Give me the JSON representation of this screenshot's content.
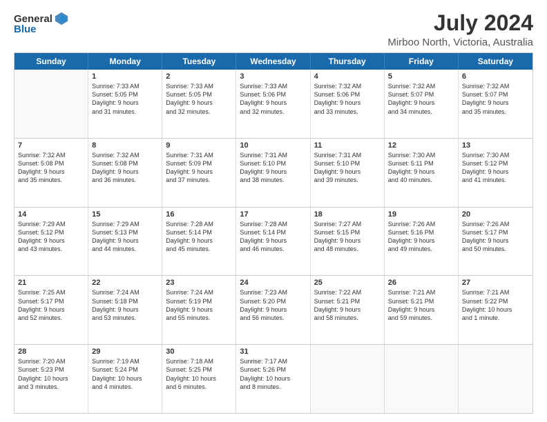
{
  "logo": {
    "general": "General",
    "blue": "Blue"
  },
  "title": "July 2024",
  "location": "Mirboo North, Victoria, Australia",
  "days_of_week": [
    "Sunday",
    "Monday",
    "Tuesday",
    "Wednesday",
    "Thursday",
    "Friday",
    "Saturday"
  ],
  "weeks": [
    [
      {
        "day": "",
        "lines": []
      },
      {
        "day": "1",
        "lines": [
          "Sunrise: 7:33 AM",
          "Sunset: 5:05 PM",
          "Daylight: 9 hours",
          "and 31 minutes."
        ]
      },
      {
        "day": "2",
        "lines": [
          "Sunrise: 7:33 AM",
          "Sunset: 5:05 PM",
          "Daylight: 9 hours",
          "and 32 minutes."
        ]
      },
      {
        "day": "3",
        "lines": [
          "Sunrise: 7:33 AM",
          "Sunset: 5:06 PM",
          "Daylight: 9 hours",
          "and 32 minutes."
        ]
      },
      {
        "day": "4",
        "lines": [
          "Sunrise: 7:32 AM",
          "Sunset: 5:06 PM",
          "Daylight: 9 hours",
          "and 33 minutes."
        ]
      },
      {
        "day": "5",
        "lines": [
          "Sunrise: 7:32 AM",
          "Sunset: 5:07 PM",
          "Daylight: 9 hours",
          "and 34 minutes."
        ]
      },
      {
        "day": "6",
        "lines": [
          "Sunrise: 7:32 AM",
          "Sunset: 5:07 PM",
          "Daylight: 9 hours",
          "and 35 minutes."
        ]
      }
    ],
    [
      {
        "day": "7",
        "lines": [
          "Sunrise: 7:32 AM",
          "Sunset: 5:08 PM",
          "Daylight: 9 hours",
          "and 35 minutes."
        ]
      },
      {
        "day": "8",
        "lines": [
          "Sunrise: 7:32 AM",
          "Sunset: 5:08 PM",
          "Daylight: 9 hours",
          "and 36 minutes."
        ]
      },
      {
        "day": "9",
        "lines": [
          "Sunrise: 7:31 AM",
          "Sunset: 5:09 PM",
          "Daylight: 9 hours",
          "and 37 minutes."
        ]
      },
      {
        "day": "10",
        "lines": [
          "Sunrise: 7:31 AM",
          "Sunset: 5:10 PM",
          "Daylight: 9 hours",
          "and 38 minutes."
        ]
      },
      {
        "day": "11",
        "lines": [
          "Sunrise: 7:31 AM",
          "Sunset: 5:10 PM",
          "Daylight: 9 hours",
          "and 39 minutes."
        ]
      },
      {
        "day": "12",
        "lines": [
          "Sunrise: 7:30 AM",
          "Sunset: 5:11 PM",
          "Daylight: 9 hours",
          "and 40 minutes."
        ]
      },
      {
        "day": "13",
        "lines": [
          "Sunrise: 7:30 AM",
          "Sunset: 5:12 PM",
          "Daylight: 9 hours",
          "and 41 minutes."
        ]
      }
    ],
    [
      {
        "day": "14",
        "lines": [
          "Sunrise: 7:29 AM",
          "Sunset: 5:12 PM",
          "Daylight: 9 hours",
          "and 43 minutes."
        ]
      },
      {
        "day": "15",
        "lines": [
          "Sunrise: 7:29 AM",
          "Sunset: 5:13 PM",
          "Daylight: 9 hours",
          "and 44 minutes."
        ]
      },
      {
        "day": "16",
        "lines": [
          "Sunrise: 7:28 AM",
          "Sunset: 5:14 PM",
          "Daylight: 9 hours",
          "and 45 minutes."
        ]
      },
      {
        "day": "17",
        "lines": [
          "Sunrise: 7:28 AM",
          "Sunset: 5:14 PM",
          "Daylight: 9 hours",
          "and 46 minutes."
        ]
      },
      {
        "day": "18",
        "lines": [
          "Sunrise: 7:27 AM",
          "Sunset: 5:15 PM",
          "Daylight: 9 hours",
          "and 48 minutes."
        ]
      },
      {
        "day": "19",
        "lines": [
          "Sunrise: 7:26 AM",
          "Sunset: 5:16 PM",
          "Daylight: 9 hours",
          "and 49 minutes."
        ]
      },
      {
        "day": "20",
        "lines": [
          "Sunrise: 7:26 AM",
          "Sunset: 5:17 PM",
          "Daylight: 9 hours",
          "and 50 minutes."
        ]
      }
    ],
    [
      {
        "day": "21",
        "lines": [
          "Sunrise: 7:25 AM",
          "Sunset: 5:17 PM",
          "Daylight: 9 hours",
          "and 52 minutes."
        ]
      },
      {
        "day": "22",
        "lines": [
          "Sunrise: 7:24 AM",
          "Sunset: 5:18 PM",
          "Daylight: 9 hours",
          "and 53 minutes."
        ]
      },
      {
        "day": "23",
        "lines": [
          "Sunrise: 7:24 AM",
          "Sunset: 5:19 PM",
          "Daylight: 9 hours",
          "and 55 minutes."
        ]
      },
      {
        "day": "24",
        "lines": [
          "Sunrise: 7:23 AM",
          "Sunset: 5:20 PM",
          "Daylight: 9 hours",
          "and 56 minutes."
        ]
      },
      {
        "day": "25",
        "lines": [
          "Sunrise: 7:22 AM",
          "Sunset: 5:21 PM",
          "Daylight: 9 hours",
          "and 58 minutes."
        ]
      },
      {
        "day": "26",
        "lines": [
          "Sunrise: 7:21 AM",
          "Sunset: 5:21 PM",
          "Daylight: 9 hours",
          "and 59 minutes."
        ]
      },
      {
        "day": "27",
        "lines": [
          "Sunrise: 7:21 AM",
          "Sunset: 5:22 PM",
          "Daylight: 10 hours",
          "and 1 minute."
        ]
      }
    ],
    [
      {
        "day": "28",
        "lines": [
          "Sunrise: 7:20 AM",
          "Sunset: 5:23 PM",
          "Daylight: 10 hours",
          "and 3 minutes."
        ]
      },
      {
        "day": "29",
        "lines": [
          "Sunrise: 7:19 AM",
          "Sunset: 5:24 PM",
          "Daylight: 10 hours",
          "and 4 minutes."
        ]
      },
      {
        "day": "30",
        "lines": [
          "Sunrise: 7:18 AM",
          "Sunset: 5:25 PM",
          "Daylight: 10 hours",
          "and 6 minutes."
        ]
      },
      {
        "day": "31",
        "lines": [
          "Sunrise: 7:17 AM",
          "Sunset: 5:26 PM",
          "Daylight: 10 hours",
          "and 8 minutes."
        ]
      },
      {
        "day": "",
        "lines": []
      },
      {
        "day": "",
        "lines": []
      },
      {
        "day": "",
        "lines": []
      }
    ]
  ]
}
